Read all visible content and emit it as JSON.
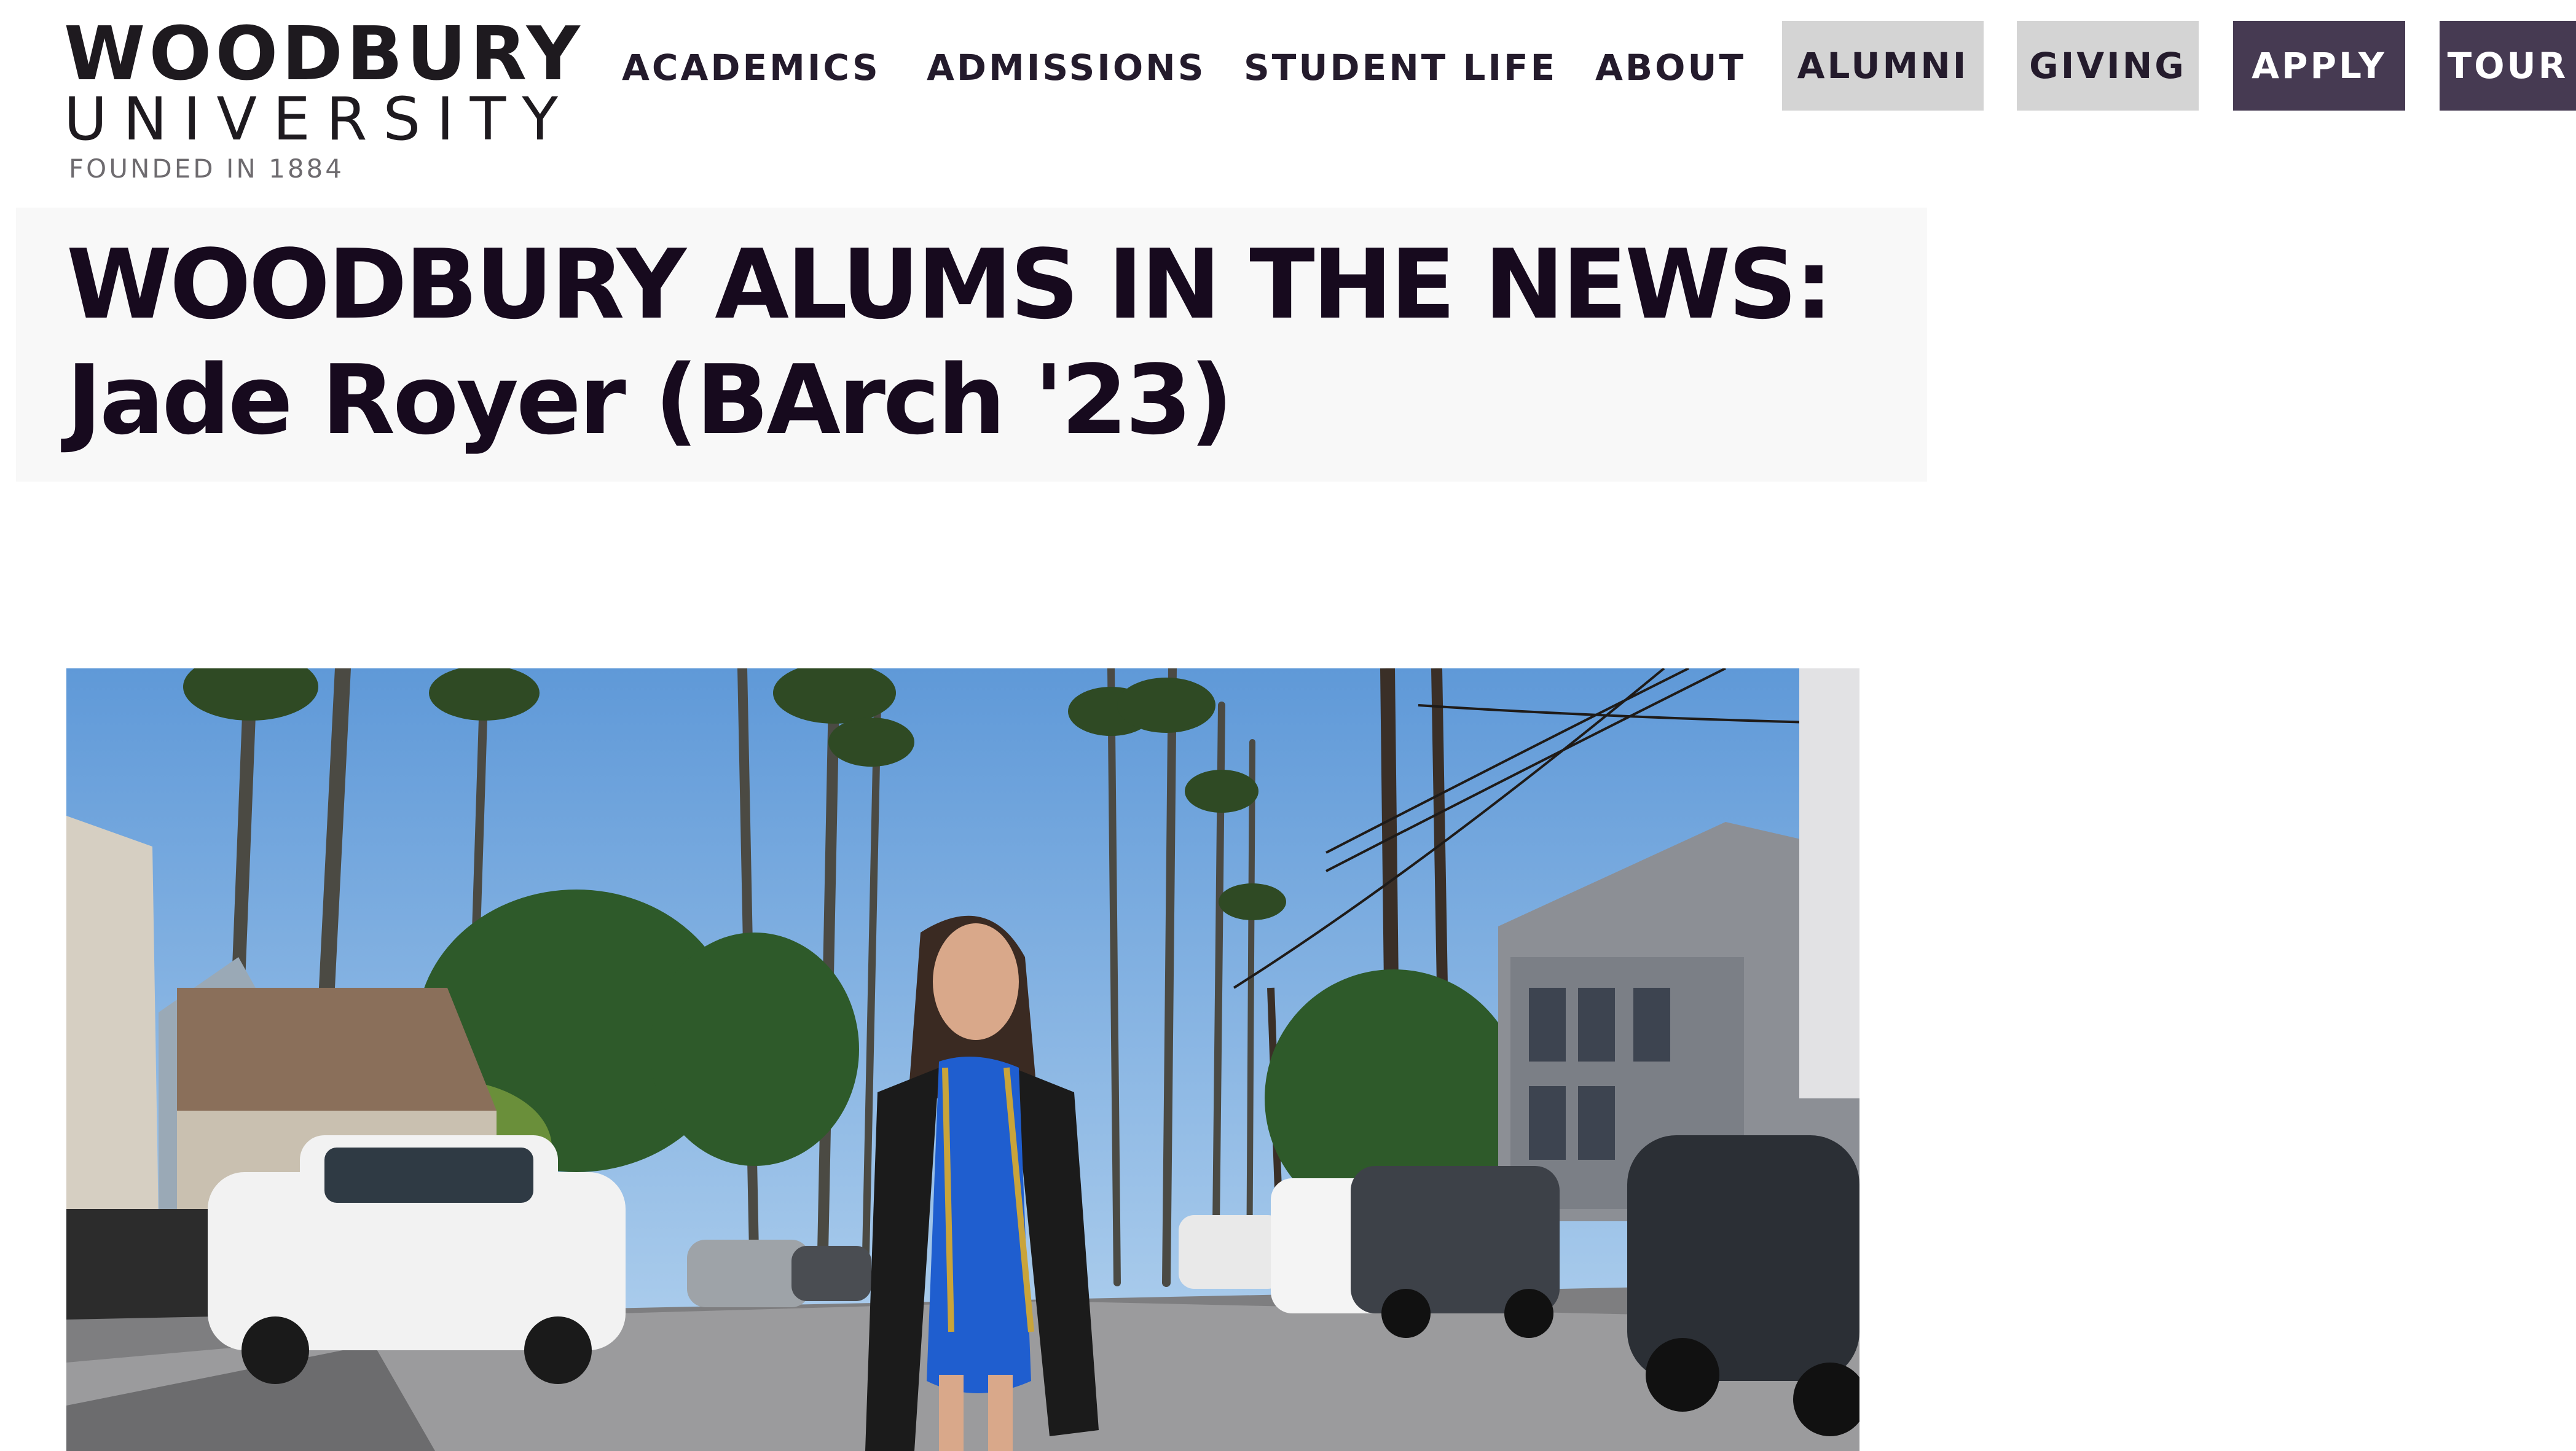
{
  "logo": {
    "main": "WOODBURY",
    "sub": "UNIVERSITY",
    "founded": "FOUNDED IN 1884"
  },
  "nav": {
    "links": [
      {
        "label": "ACADEMICS"
      },
      {
        "label": "ADMISSIONS"
      },
      {
        "label": "STUDENT LIFE"
      },
      {
        "label": "ABOUT"
      }
    ],
    "buttons": [
      {
        "label": "ALUMNI",
        "style": "grey"
      },
      {
        "label": "GIVING",
        "style": "grey"
      },
      {
        "label": "APPLY",
        "style": "purple"
      },
      {
        "label": "TOUR",
        "style": "purple"
      }
    ]
  },
  "article": {
    "title_line1": "WOODBURY ALUMS IN THE NEWS:",
    "title_line2": "Jade Royer (BArch '23)"
  },
  "colors": {
    "brand_purple": "#463a52",
    "nav_grey": "#d4d4d4",
    "title_text": "#170a1e",
    "banner_bg": "#f8f8f8"
  }
}
